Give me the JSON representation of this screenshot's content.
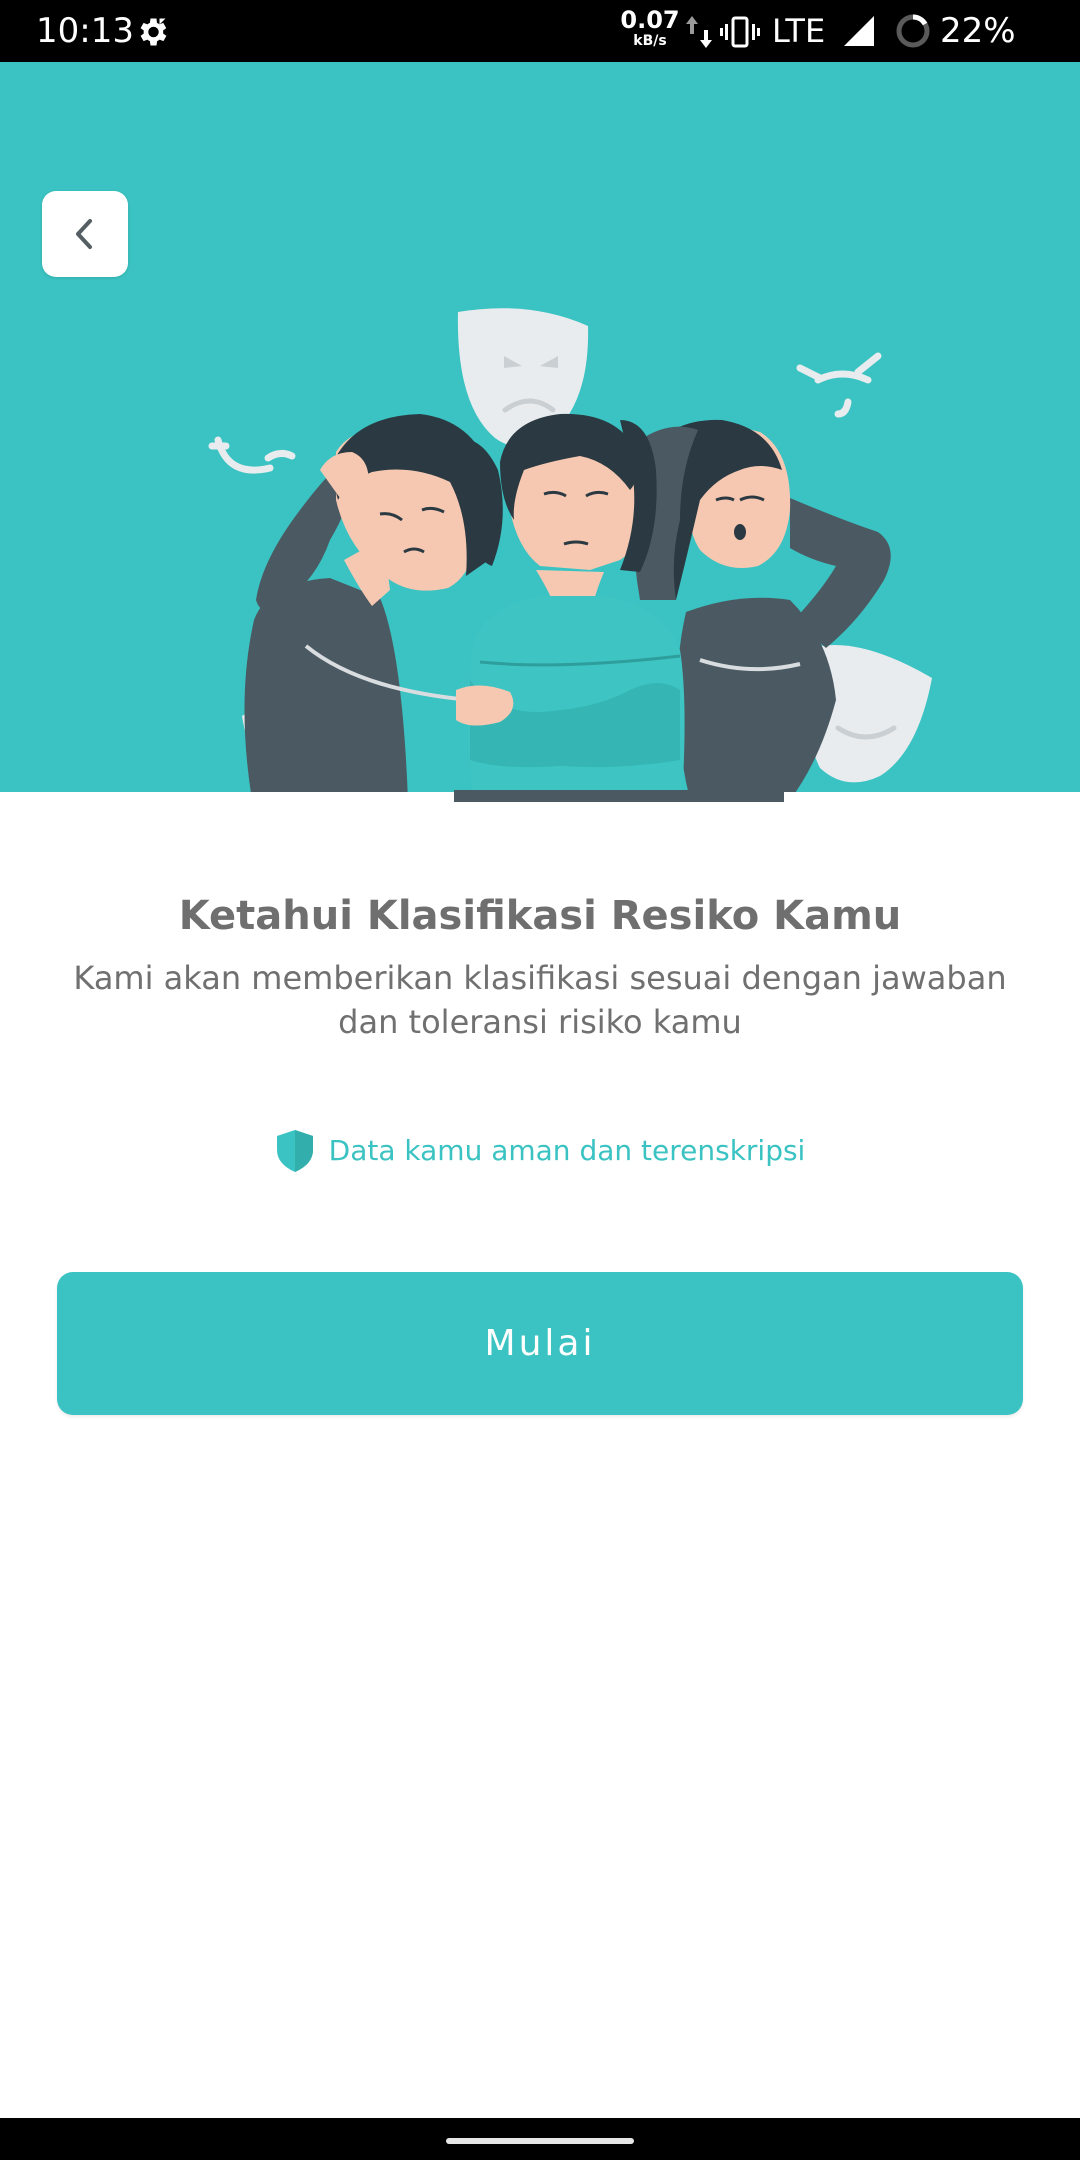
{
  "status_bar": {
    "time": "10:13",
    "net_speed_value": "0.07",
    "net_speed_unit": "kB/s",
    "network_type": "LTE",
    "battery": "22%",
    "icons": [
      "gear-icon",
      "data-arrows-icon",
      "vibrate-icon",
      "signal-icon",
      "battery-ring-icon"
    ]
  },
  "hero": {
    "background_color": "#3AC3C2",
    "illustration": "three-women-with-mood-masks"
  },
  "back_button": {
    "icon": "chevron-left-icon"
  },
  "content": {
    "title": "Ketahui Klasifikasi Resiko Kamu",
    "subtitle": "Kami akan memberikan klasifikasi sesuai dengan jawaban dan toleransi risiko kamu",
    "secure_note": "Data kamu aman dan terenskripsi",
    "secure_icon": "shield-icon"
  },
  "actions": {
    "start_label": "Mulai"
  },
  "colors": {
    "accent": "#3AC3C2",
    "title_text": "#6f6f6f",
    "body_text": "#707070"
  }
}
